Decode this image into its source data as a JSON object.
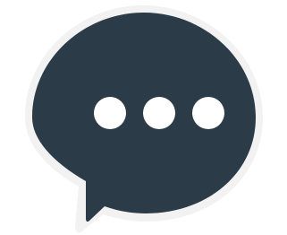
{
  "icon": {
    "name": "chat-bubble-typing-icon",
    "dot_count": 3
  },
  "colors": {
    "background": "#ffffff",
    "bubble_fill": "#2b3b47",
    "bubble_outline": "#f2f2f2",
    "dots": "#ffffff"
  }
}
